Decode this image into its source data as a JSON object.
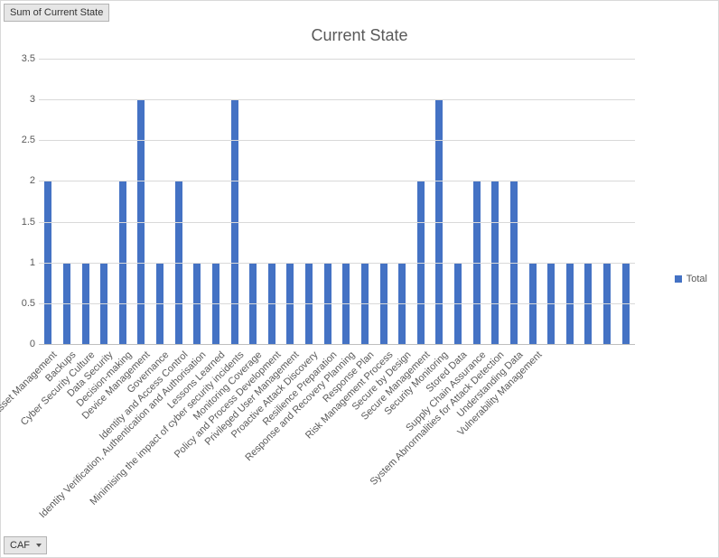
{
  "field_button_label": "Sum of Current State",
  "caf_button_label": "CAF",
  "chart_data": {
    "type": "bar",
    "title": "Current State",
    "xlabel": "",
    "ylabel": "",
    "ylim": [
      0,
      3.5
    ],
    "ytick_step": 0.5,
    "legend": [
      "Total"
    ],
    "categories": [
      "Asset Management",
      "Backups",
      "Cyber Security Culture",
      "Data Security",
      "Decision-making",
      "Device Management",
      "Governance",
      "Identity and Access Control",
      "Identity Verification, Authentication and Authorisation",
      "Lessons Learned",
      "Minimising the impact of cyber security incidents",
      "Monitoring Coverage",
      "Policy and Process Development",
      "Privileged User Management",
      "Proactive Attack Discovery",
      "Resilience Preparation",
      "Response and Recovery Planning",
      "Response Plan",
      "Risk Management Process",
      "Secure by Design",
      "Secure Management",
      "Security Monitoring",
      "Stored Data",
      "Supply Chain Assurance",
      "System Abnormalities for Attack Detection",
      "Understanding Data",
      "Vulnerability Management"
    ],
    "series": [
      {
        "name": "Total",
        "values": [
          2,
          1,
          1,
          1,
          2,
          3,
          1,
          2,
          1,
          1,
          3,
          1,
          1,
          1,
          1,
          1,
          1,
          1,
          1,
          1,
          2,
          3,
          1,
          2,
          2,
          2,
          1,
          1,
          1,
          1,
          1,
          1
        ]
      }
    ]
  }
}
